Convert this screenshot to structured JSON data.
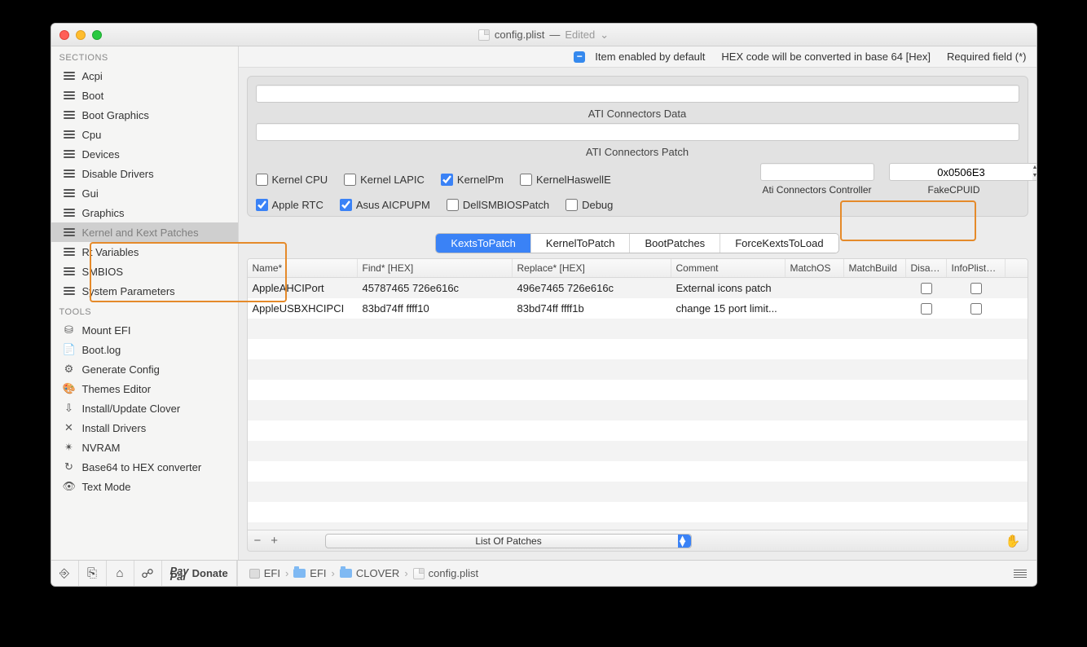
{
  "title": {
    "filename": "config.plist",
    "status": "Edited"
  },
  "topbar": {
    "itemEnabled": "Item enabled by default",
    "hexNote": "HEX code will be converted in base 64 [Hex]",
    "required": "Required field (*)"
  },
  "sidebar": {
    "sectionsLabel": "SECTIONS",
    "toolsLabel": "TOOLS",
    "sections": [
      {
        "label": "Acpi"
      },
      {
        "label": "Boot"
      },
      {
        "label": "Boot Graphics"
      },
      {
        "label": "Cpu"
      },
      {
        "label": "Devices"
      },
      {
        "label": "Disable Drivers"
      },
      {
        "label": "Gui"
      },
      {
        "label": "Graphics"
      },
      {
        "label": "Kernel and Kext Patches"
      },
      {
        "label": "Rt Variables"
      },
      {
        "label": "SMBIOS"
      },
      {
        "label": "System Parameters"
      }
    ],
    "tools": [
      {
        "icon": "⛁",
        "label": "Mount EFI"
      },
      {
        "icon": "📄",
        "label": "Boot.log"
      },
      {
        "icon": "⚙",
        "label": "Generate Config"
      },
      {
        "icon": "🎨",
        "label": "Themes Editor"
      },
      {
        "icon": "⇩",
        "label": "Install/Update Clover"
      },
      {
        "icon": "✕",
        "label": "Install Drivers"
      },
      {
        "icon": "✴",
        "label": "NVRAM"
      },
      {
        "icon": "↻",
        "label": "Base64 to HEX converter"
      },
      {
        "icon": "👁",
        "label": "Text Mode"
      }
    ]
  },
  "panel": {
    "atiDataLabel": "ATI Connectors Data",
    "atiPatchLabel": "ATI Connectors Patch",
    "checkboxes": {
      "row1": [
        {
          "label": "Kernel CPU",
          "checked": false
        },
        {
          "label": "Kernel LAPIC",
          "checked": false
        },
        {
          "label": "KernelPm",
          "checked": true
        },
        {
          "label": "KernelHaswellE",
          "checked": false
        }
      ],
      "row2": [
        {
          "label": "Apple RTC",
          "checked": true
        },
        {
          "label": "Asus AICPUPM",
          "checked": true
        },
        {
          "label": "DellSMBIOSPatch",
          "checked": false
        },
        {
          "label": "Debug",
          "checked": false
        }
      ]
    },
    "atiControllerLabel": "Ati Connectors Controller",
    "fakeCpuidLabel": "FakeCPUID",
    "fakeCpuidValue": "0x0506E3"
  },
  "tabs": [
    "KextsToPatch",
    "KernelToPatch",
    "BootPatches",
    "ForceKextsToLoad"
  ],
  "table": {
    "headers": [
      "Name*",
      "Find* [HEX]",
      "Replace* [HEX]",
      "Comment",
      "MatchOS",
      "MatchBuild",
      "Disabl...",
      "InfoPlistPat..."
    ],
    "rows": [
      {
        "name": "AppleAHCIPort",
        "find": "45787465 726e616c",
        "replace": "496e7465 726e616c",
        "comment": "External icons patch",
        "matchos": "",
        "matchbuild": "",
        "disabled": false,
        "infoplist": false
      },
      {
        "name": "AppleUSBXHCIPCI",
        "find": "83bd74ff ffff10",
        "replace": "83bd74ff ffff1b",
        "comment": "change 15 port limit...",
        "matchos": "",
        "matchbuild": "",
        "disabled": false,
        "infoplist": false
      }
    ],
    "dropdownLabel": "List Of Patches"
  },
  "statusbar": {
    "buttons": [
      {
        "icon": "⎆"
      },
      {
        "icon": "⎘"
      },
      {
        "icon": "⌂"
      },
      {
        "icon": "☍"
      }
    ],
    "donate": "Donate",
    "breadcrumb": [
      "EFI",
      "EFI",
      "CLOVER",
      "config.plist"
    ]
  }
}
